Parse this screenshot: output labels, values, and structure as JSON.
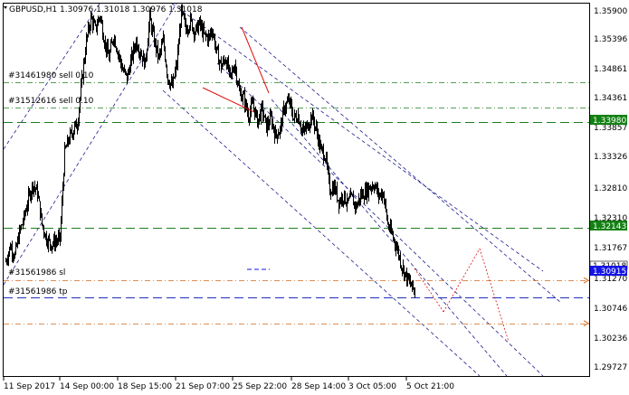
{
  "window": {
    "symbol_title": "GBPUSD,H1  1.30976 1.31018 1.30976 1.31018"
  },
  "colors": {
    "background": "#ffffff",
    "candles": "#000000",
    "green_line": "#1e7d1e",
    "green_tag": "#138013",
    "blue_line": "#1f2fbf",
    "blue_tag": "#1414e6",
    "orange_line": "#d2691e",
    "channel": "#1e1e8c",
    "red_lines": "#e01010"
  },
  "price_axis": {
    "labels": [
      "1.35900",
      "1.35396",
      "1.34861",
      "1.34361",
      "1.33857",
      "1.33326",
      "1.32810",
      "1.32310",
      "1.31767",
      "1.31270",
      "1.30746",
      "1.30236",
      "1.29727"
    ],
    "current_price_label": "1.31018",
    "level_tags": [
      {
        "price": "1.33980",
        "color": "green"
      },
      {
        "price": "1.32143",
        "color": "green"
      },
      {
        "price": "1.30915",
        "color": "blue"
      }
    ]
  },
  "time_axis": {
    "labels": [
      "11 Sep 2017",
      "14 Sep 00:00",
      "18 Sep 15:00",
      "21 Sep 07:00",
      "25 Sep 22:00",
      "28 Sep 14:00",
      "3 Oct 05:00",
      "5 Oct 21:00"
    ]
  },
  "order_labels": [
    {
      "text": "#31461980 sell 0.10",
      "kind": "order"
    },
    {
      "text": "#31512616 sell 0.10",
      "kind": "order"
    },
    {
      "text": "#31561986 sl",
      "kind": "sl"
    },
    {
      "text": "#31561986 tp",
      "kind": "tp"
    }
  ],
  "chart_data": {
    "type": "candlestick",
    "symbol": "GBPUSD",
    "timeframe": "H1",
    "ylim": [
      1.2955,
      1.3605
    ],
    "y_ticks": [
      1.359,
      1.35396,
      1.34861,
      1.34361,
      1.33857,
      1.33326,
      1.3281,
      1.3231,
      1.31767,
      1.3127,
      1.30746,
      1.30236,
      1.29727
    ],
    "price_path": [
      1.3155,
      1.3182,
      1.3165,
      1.3205,
      1.323,
      1.3265,
      1.329,
      1.3275,
      1.322,
      1.3195,
      1.3185,
      1.319,
      1.3195,
      1.3345,
      1.337,
      1.3385,
      1.3395,
      1.347,
      1.354,
      1.358,
      1.356,
      1.3585,
      1.354,
      1.351,
      1.355,
      1.352,
      1.349,
      1.3475,
      1.351,
      1.354,
      1.352,
      1.35,
      1.358,
      1.354,
      1.351,
      1.354,
      1.3475,
      1.346,
      1.35,
      1.359,
      1.356,
      1.3575,
      1.3555,
      1.357,
      1.355,
      1.3545,
      1.356,
      1.352,
      1.3495,
      1.351,
      1.3475,
      1.35,
      1.345,
      1.344,
      1.341,
      1.343,
      1.34,
      1.342,
      1.339,
      1.3405,
      1.3375,
      1.3385,
      1.3425,
      1.3435,
      1.3405,
      1.341,
      1.338,
      1.339,
      1.341,
      1.3385,
      1.335,
      1.334,
      1.328,
      1.3285,
      1.326,
      1.327,
      1.3255,
      1.3265,
      1.325,
      1.327,
      1.3275,
      1.3285,
      1.329,
      1.327,
      1.3275,
      1.322,
      1.32,
      1.318,
      1.315,
      1.313,
      1.3115,
      1.3102
    ],
    "horizontal_levels": [
      {
        "price": 1.3468,
        "style": "dash-dot",
        "color": "green",
        "label": "#31461980 sell 0.10"
      },
      {
        "price": 1.3423,
        "style": "dash-dot",
        "color": "green",
        "label": "#31512616 sell 0.10"
      },
      {
        "price": 1.3398,
        "style": "dashed",
        "color": "green",
        "tag": "1.33980"
      },
      {
        "price": 1.32143,
        "style": "dashed",
        "color": "green",
        "tag": "1.32143"
      },
      {
        "price": 1.3122,
        "style": "dash-dot",
        "color": "orange",
        "label": "#31561986 sl"
      },
      {
        "price": 1.30915,
        "style": "dashed",
        "color": "blue",
        "tag": "1.30915"
      },
      {
        "price": 1.3047,
        "style": "dash-dot",
        "color": "orange",
        "label": "#31561986 tp"
      }
    ],
    "last_price": 1.31018,
    "grid": false
  }
}
